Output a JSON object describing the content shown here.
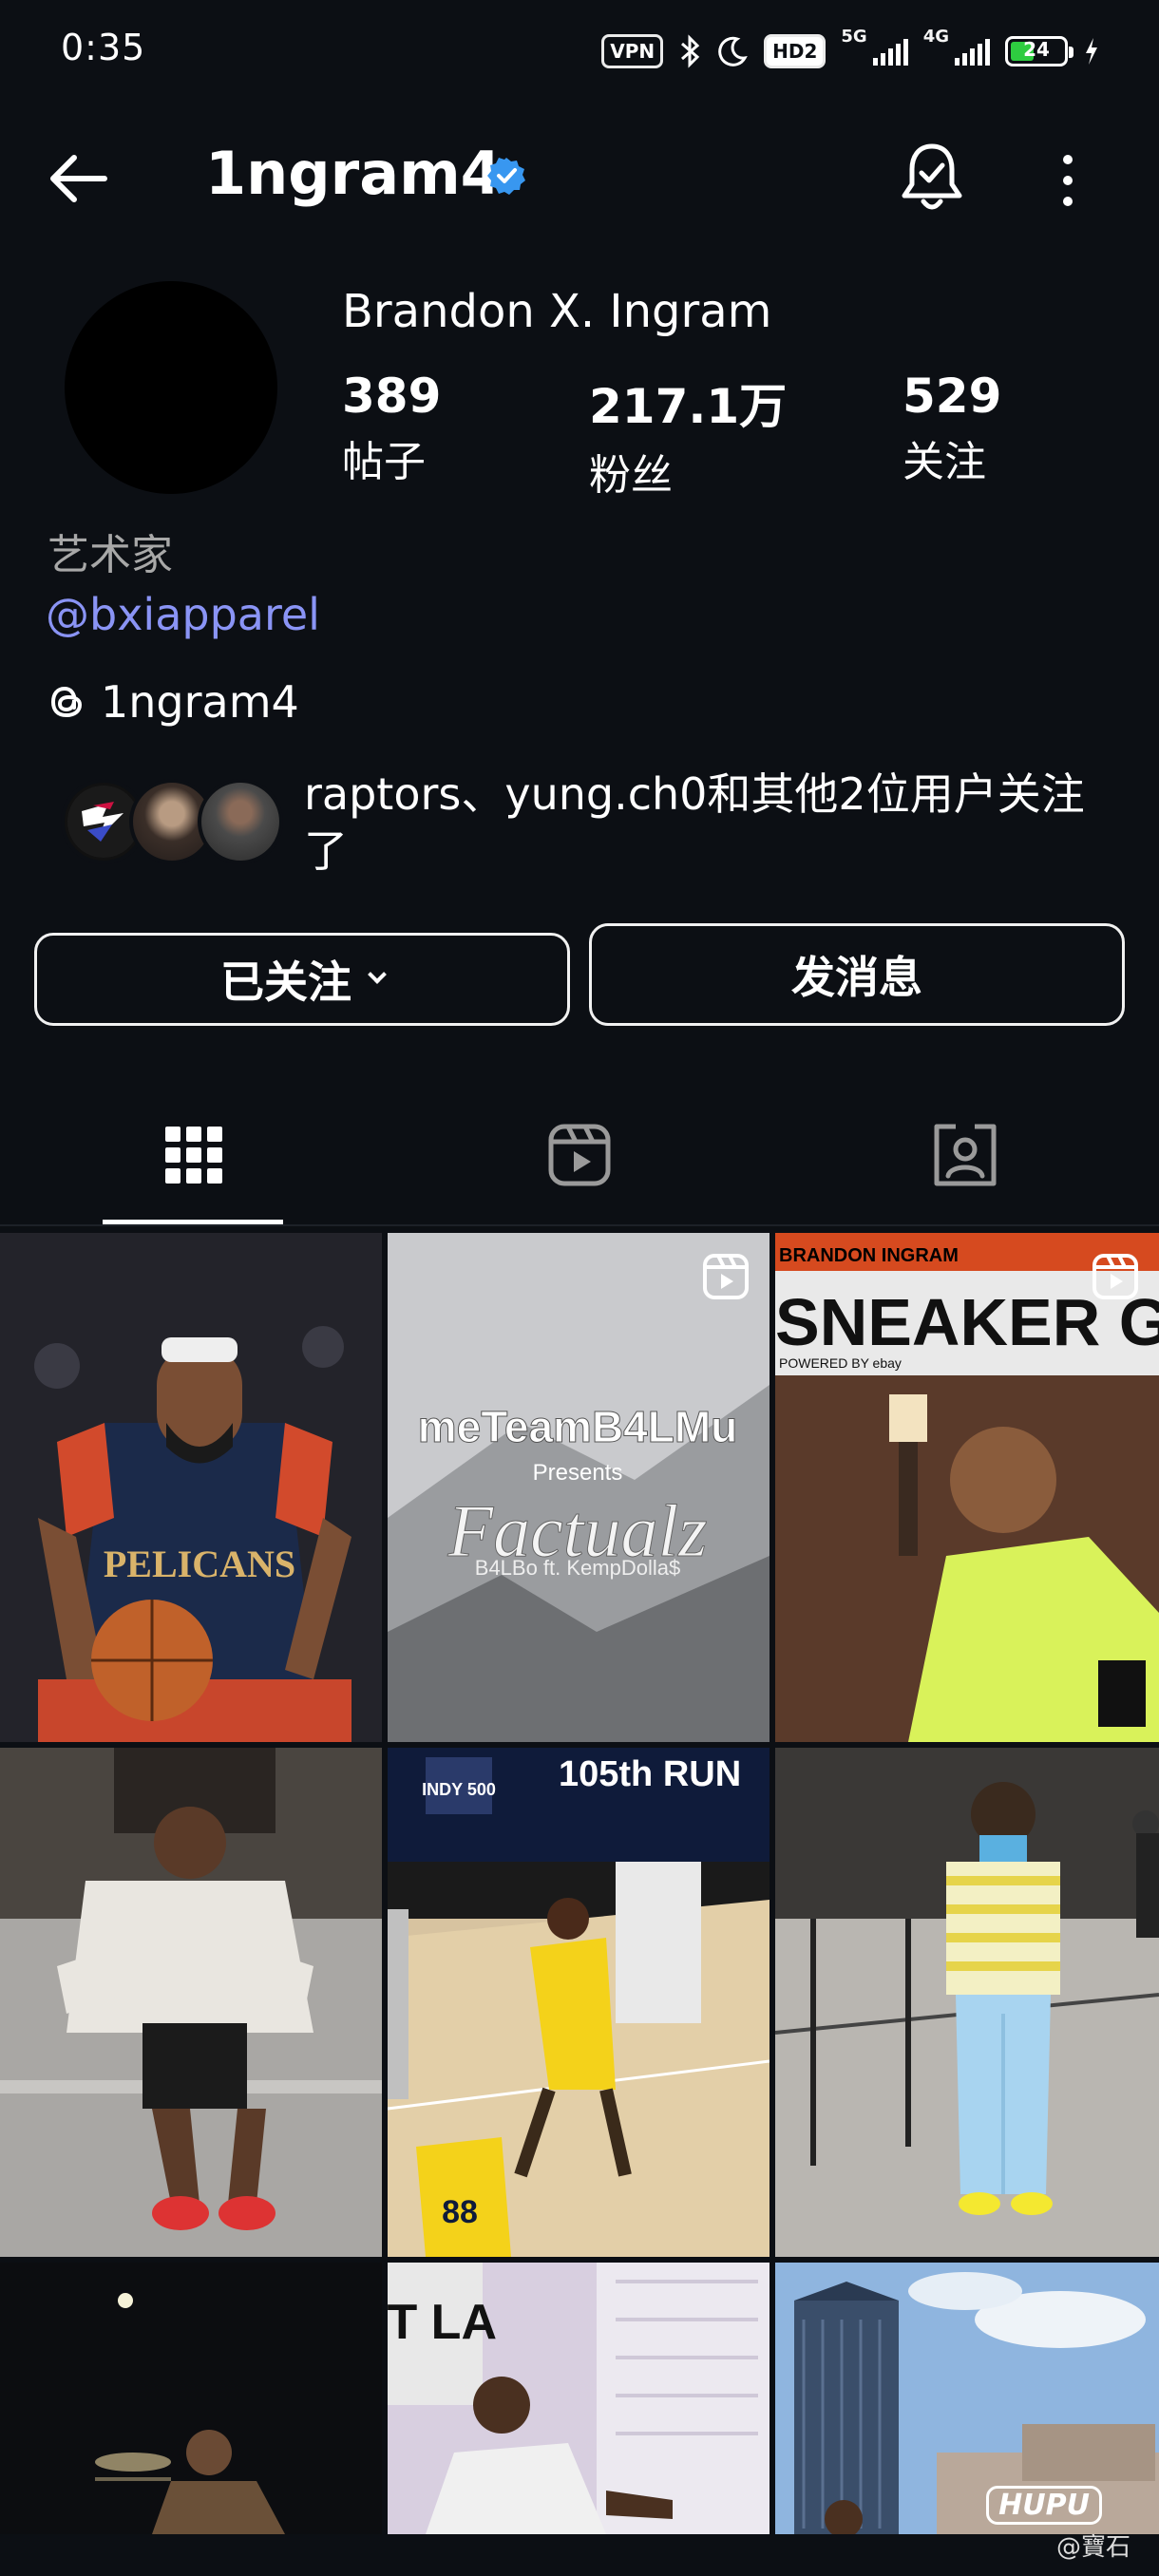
{
  "status_bar": {
    "time": "0:35",
    "vpn_label": "VPN",
    "hd_label": "HD2",
    "net1": "5G",
    "net2": "4G",
    "battery": "24"
  },
  "header": {
    "username": "1ngram4",
    "verified": true
  },
  "profile": {
    "full_name": "Brandon X. Ingram",
    "stats": [
      {
        "value": "389",
        "label": "帖子"
      },
      {
        "value": "217.1万",
        "label": "粉丝"
      },
      {
        "value": "529",
        "label": "关注"
      }
    ],
    "category": "艺术家",
    "link": "@bxiapparel",
    "threads_handle": "1ngram4",
    "followed_by": "raptors、yung.ch0和其他2位用户关注了"
  },
  "actions": {
    "following_label": "已关注",
    "message_label": "发消息"
  },
  "tabs": [
    {
      "icon": "grid-icon",
      "active": true
    },
    {
      "icon": "reels-icon",
      "active": false
    },
    {
      "icon": "tagged-icon",
      "active": false
    }
  ],
  "posts": {
    "post2_line1": "meTeamB4LMu",
    "post2_line2": "Presents",
    "post2_line3": "Factualz",
    "post2_line4": "B4LBo ft. KempDolla$",
    "post3_header": "BRANDON INGRAM",
    "post3_title": "SNEAKER GM",
    "post3_powered": "POWERED BY ebay",
    "post1_jersey": "PELICANS",
    "post5_banner": "105th RUN",
    "post5_badge": "INDY 500",
    "post5_number": "88",
    "post8_sign": "IT LA"
  },
  "colors": {
    "background": "#0c0f14",
    "link": "#8a94f5",
    "verified": "#3897f0"
  },
  "watermark": {
    "brand": "HUPU",
    "credit": "@寶石"
  }
}
